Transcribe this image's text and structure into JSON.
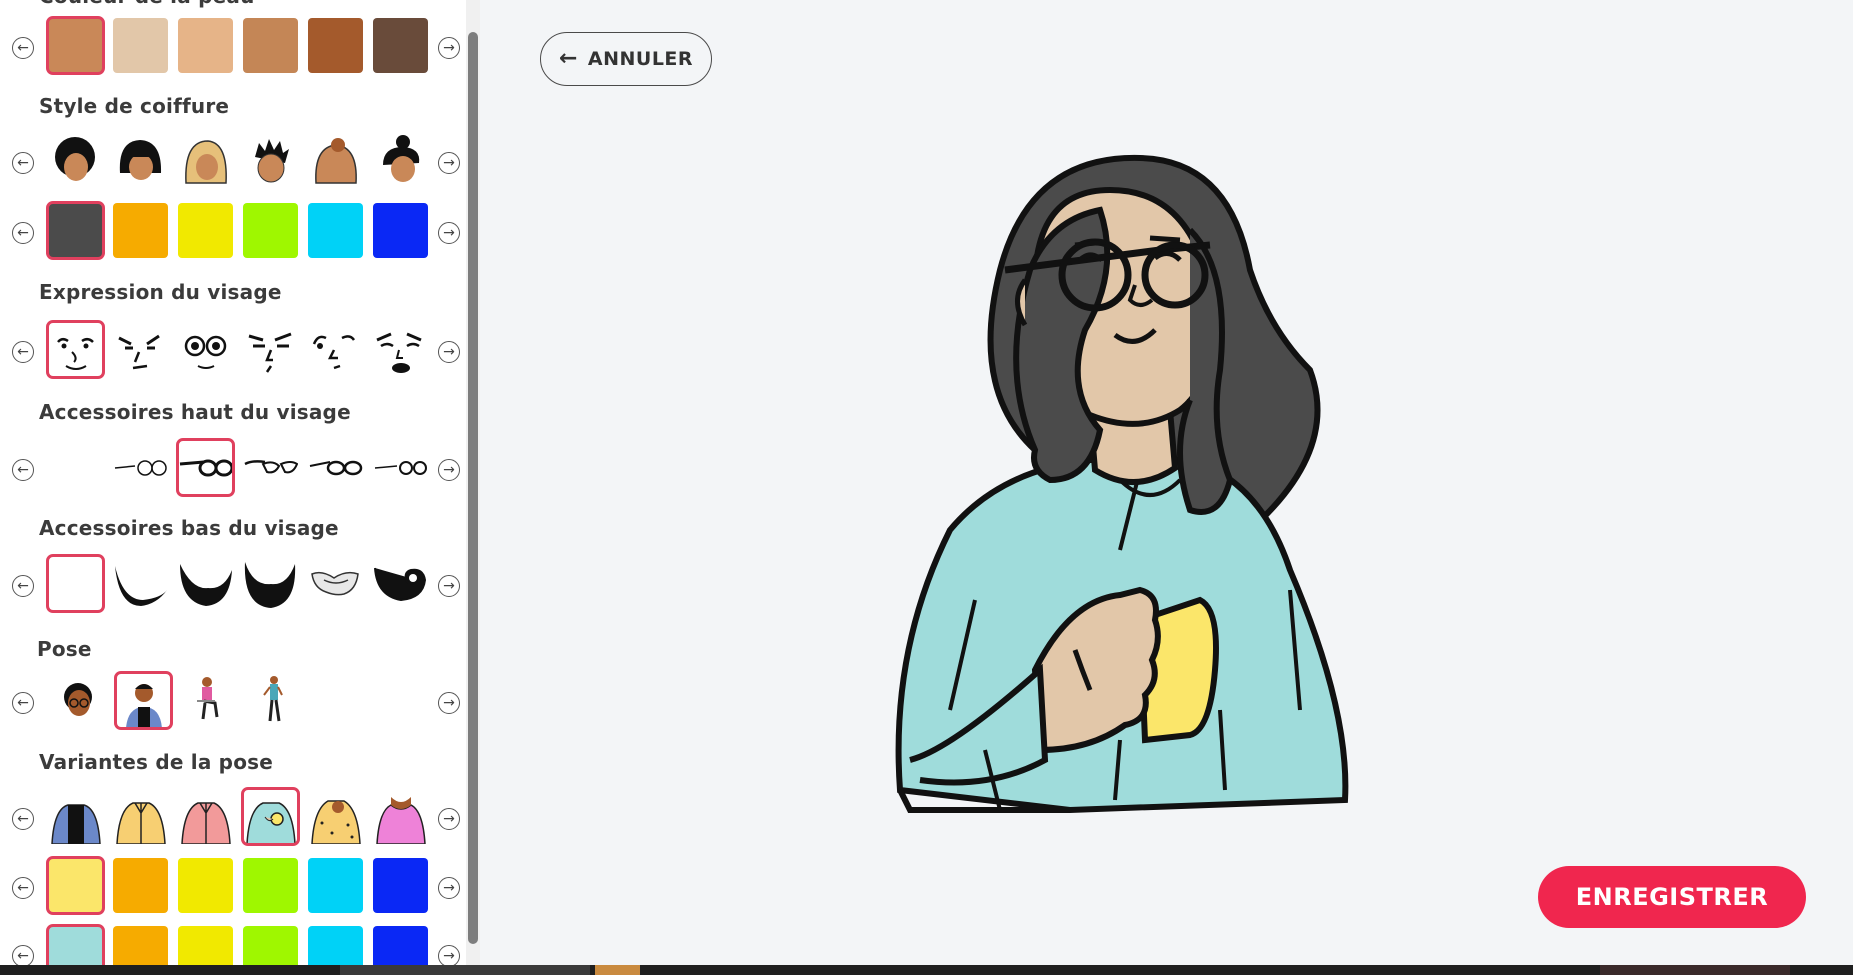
{
  "sidebar": {
    "sections": {
      "skin_title": "Couleur de la peau",
      "hair_title": "Style de coiffure",
      "expression_title": "Expression du visage",
      "top_accessories_title": "Accessoires haut du visage",
      "bottom_accessories_title": "Accessoires bas du visage",
      "pose_title": "Pose",
      "pose_variants_title": "Variantes de la pose"
    },
    "skin_colors": [
      "#c98858",
      "#e2c7a9",
      "#e6b488",
      "#c48656",
      "#a45a2c",
      "#694b3a"
    ],
    "hair_colors": [
      "#4b4b4b",
      "#f6ab00",
      "#f1e900",
      "#9ff700",
      "#00d2f7",
      "#0a28f5"
    ],
    "clothing_colors": [
      "#fbe66a",
      "#f6ab00",
      "#f1e900",
      "#9ff700",
      "#00d2f7",
      "#0a28f5"
    ],
    "clothing_colors_2": [
      "#9fdcdb",
      "#f6ab00",
      "#f1e900",
      "#9ff700",
      "#00d2f7",
      "#0a28f5"
    ],
    "hair_styles": [
      "afro-hair-icon",
      "bob-bangs-hair-icon",
      "blonde-long-hair-icon",
      "spiky-hair-icon",
      "bun-hair-icon",
      "updo-hair-icon"
    ],
    "expressions": [
      "smile-face-icon",
      "wink-face-icon",
      "surprised-face-icon",
      "angry-face-icon",
      "squint-face-icon",
      "sad-face-icon"
    ],
    "top_accessories": [
      "none",
      "round-glasses-icon",
      "bold-glasses-icon",
      "cat-eye-glasses-icon",
      "thin-glasses-icon",
      "small-glasses-icon"
    ],
    "bottom_accessories": [
      "none-icon",
      "chin-beard-icon",
      "mustache-beard-icon",
      "full-beard-icon",
      "light-moustache-icon",
      "goatee-icon"
    ],
    "poses": [
      "head-pose-icon",
      "bust-pose-icon",
      "sitting-pose-icon",
      "standing-pose-icon"
    ],
    "pose_variants": [
      "blue-jacket-icon",
      "yellow-shirt-icon",
      "pink-shirt-icon",
      "mug-shirt-icon",
      "dotted-shirt-icon",
      "pink-top-icon"
    ]
  },
  "header": {
    "cancel_label": "ANNULER",
    "back_arrow_icon": "arrow-left-icon"
  },
  "footer": {
    "save_label": "ENREGISTRER"
  },
  "colors": {
    "accent": "#f0264e",
    "selected_border": "#e0405e",
    "background": "#f3f5f7"
  },
  "avatar": {
    "hair": "#4b4b4b",
    "skin": "#e2c7a9",
    "shirt": "#9fdcdb",
    "mug": "#fbe66a"
  }
}
